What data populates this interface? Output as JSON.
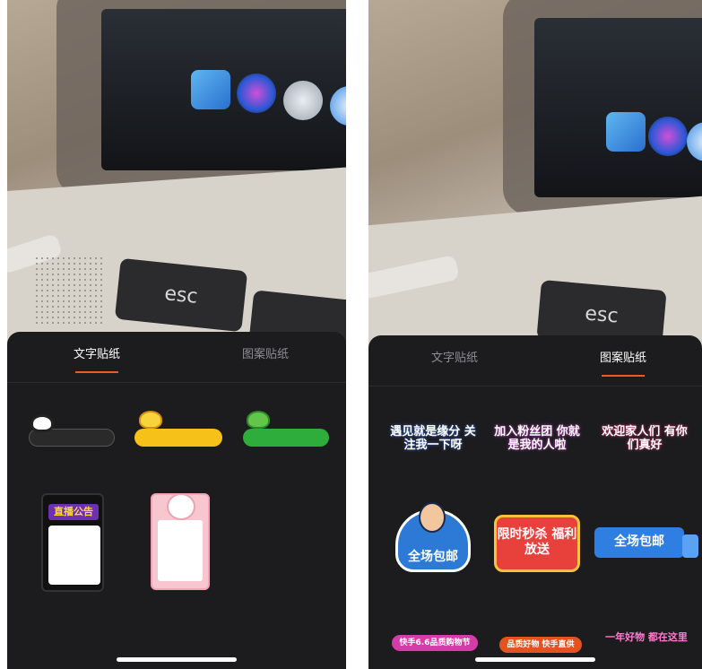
{
  "left_screen": {
    "photo": {
      "key_label": "esc"
    },
    "tabs": [
      {
        "label": "文字贴纸",
        "active": true
      },
      {
        "label": "图案贴纸",
        "active": false
      }
    ],
    "text_stickers": {
      "card1_title": "直播公告"
    }
  },
  "right_screen": {
    "photo": {
      "key_label": "esc"
    },
    "tabs": [
      {
        "label": "文字贴纸",
        "active": false
      },
      {
        "label": "图案贴纸",
        "active": true
      }
    ],
    "pattern_stickers": [
      {
        "text": "遇见就是缘分 关注我一下呀"
      },
      {
        "text": "加入粉丝团 你就是我的人啦"
      },
      {
        "text": "欢迎家人们 有你们真好"
      },
      {
        "text": "全场包邮"
      },
      {
        "text": "限时秒杀 福利放送"
      },
      {
        "text": "全场包邮"
      },
      {
        "text": "快手6.6品质购物节"
      },
      {
        "text": "品质好物 快手直供"
      },
      {
        "text": "一年好物 都在这里"
      }
    ]
  },
  "colors": {
    "accent": "#f05a28",
    "sheet_bg": "#1c1c1e",
    "inactive_tab": "#8e8e93",
    "active_tab": "#ffffff"
  }
}
